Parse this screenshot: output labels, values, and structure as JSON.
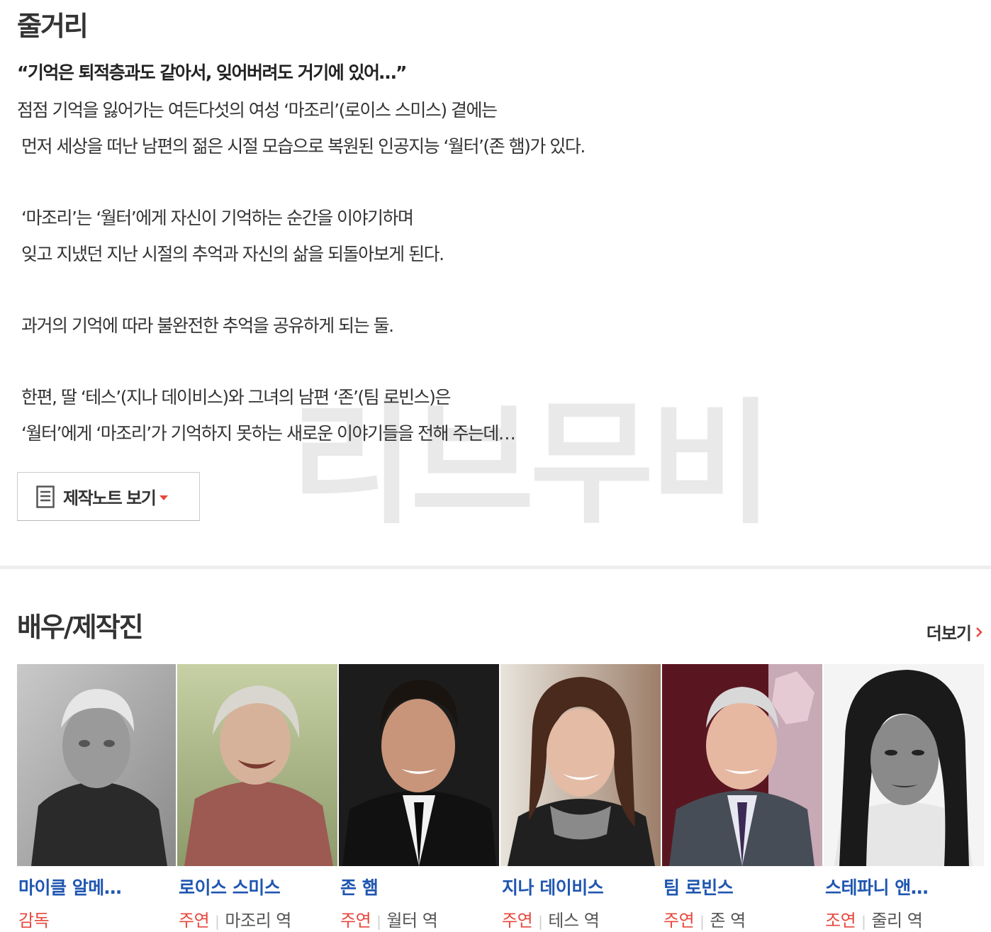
{
  "watermark": "리브무비",
  "synopsis": {
    "title": "줄거리",
    "tagline": "“기억은 퇴적층과도 같아서, 잊어버려도 거기에 있어…”",
    "paragraphs": [
      [
        "점점 기억을 잃어가는 여든다섯의 여성 ‘마조리’(로이스 스미스) 곁에는",
        "먼저 세상을 떠난 남편의 젊은 시절 모습으로 복원된 인공지능 ‘월터’(존 햄)가 있다."
      ],
      [
        "‘마조리’는 ‘월터’에게 자신이 기억하는 순간을 이야기하며",
        "잊고 지냈던 지난 시절의 추억과 자신의 삶을 되돌아보게 된다."
      ],
      [
        "과거의 기억에 따라 불완전한 추억을 공유하게 되는 둘."
      ],
      [
        "한편, 딸 ‘테스’(지나 데이비스)와 그녀의 남편 ‘존’(팀 로빈스)은",
        "‘월터’에게 ‘마조리’가 기억하지 못하는 새로운 이야기들을 전해 주는데…"
      ]
    ],
    "notes_button_label": "제작노트 보기",
    "notes_button_icon": "document-icon",
    "caret_color": "#e8473c"
  },
  "cast_section": {
    "title": "배우/제작진",
    "more_label": "더보기",
    "more_icon_color": "#e8473c",
    "name_color": "#1f56b0",
    "role_color": "#e8473c",
    "members": [
      {
        "name": "마이클 알메…",
        "role": "감독",
        "character": ""
      },
      {
        "name": "로이스 스미스",
        "role": "주연",
        "character": "마조리 역"
      },
      {
        "name": "존 햄",
        "role": "주연",
        "character": "월터 역"
      },
      {
        "name": "지나 데이비스",
        "role": "주연",
        "character": "테스 역"
      },
      {
        "name": "팀 로빈스",
        "role": "주연",
        "character": "존 역"
      },
      {
        "name": "스테파니 앤…",
        "role": "조연",
        "character": "줄리 역"
      }
    ]
  }
}
